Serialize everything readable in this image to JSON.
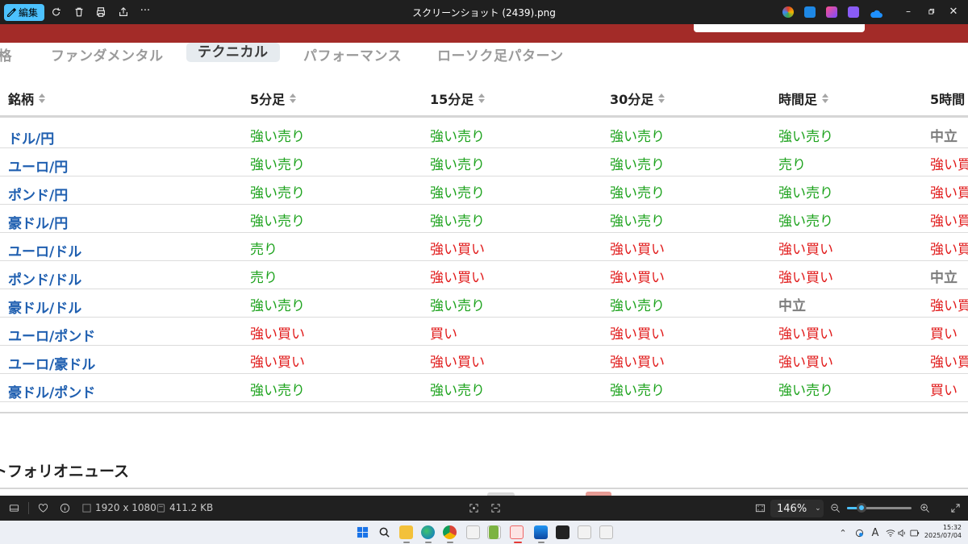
{
  "viewer": {
    "edit_label": "編集",
    "window_title": "スクリーンショット (2439).png",
    "dimensions": "1920 x 1080",
    "file_size": "411.2 KB",
    "zoom": "146%",
    "zoom_fraction": 0.22
  },
  "page": {
    "tabs": [
      {
        "label": "価格",
        "active": false
      },
      {
        "label": "ファンダメンタル",
        "active": false
      },
      {
        "label": "テクニカル",
        "active": true
      },
      {
        "label": "パフォーマンス",
        "active": false
      },
      {
        "label": "ローソク足パターン",
        "active": false
      }
    ],
    "table": {
      "headers": [
        "銘柄",
        "5分足",
        "15分足",
        "30分足",
        "時間足",
        "5時間"
      ],
      "rows": [
        {
          "symbol": "ドル/円",
          "signals": [
            "強い売り",
            "強い売り",
            "強い売り",
            "強い売り",
            "中立"
          ]
        },
        {
          "symbol": "ユーロ/円",
          "signals": [
            "強い売り",
            "強い売り",
            "強い売り",
            "売り",
            "強い買"
          ]
        },
        {
          "symbol": "ポンド/円",
          "signals": [
            "強い売り",
            "強い売り",
            "強い売り",
            "強い売り",
            "強い買"
          ]
        },
        {
          "symbol": "豪ドル/円",
          "signals": [
            "強い売り",
            "強い売り",
            "強い売り",
            "強い売り",
            "強い買"
          ]
        },
        {
          "symbol": "ユーロ/ドル",
          "signals": [
            "売り",
            "強い買い",
            "強い買い",
            "強い買い",
            "強い買"
          ]
        },
        {
          "symbol": "ポンド/ドル",
          "signals": [
            "売り",
            "強い買い",
            "強い買い",
            "強い買い",
            "中立"
          ]
        },
        {
          "symbol": "豪ドル/ドル",
          "signals": [
            "強い売り",
            "強い売り",
            "強い売り",
            "中立",
            "強い買"
          ]
        },
        {
          "symbol": "ユーロ/ポンド",
          "signals": [
            "強い買い",
            "買い",
            "強い買い",
            "強い買い",
            "買い"
          ]
        },
        {
          "symbol": "ユーロ/豪ドル",
          "signals": [
            "強い買い",
            "強い買い",
            "強い買い",
            "強い買い",
            "強い買"
          ]
        },
        {
          "symbol": "豪ドル/ポンド",
          "signals": [
            "強い売り",
            "強い売り",
            "強い売り",
            "強い売り",
            "買い"
          ]
        }
      ]
    },
    "news_heading": "トフォリオニュース"
  },
  "taskbar": {
    "time": "15:32",
    "date": "2025/07/04"
  },
  "colors": {
    "accent": "#4cc2ff",
    "site_header": "#a32b28",
    "sell": "#1ea31e",
    "buy": "#e11b1b",
    "neutral": "#7d7d7d",
    "symbol": "#1f5fb0"
  }
}
